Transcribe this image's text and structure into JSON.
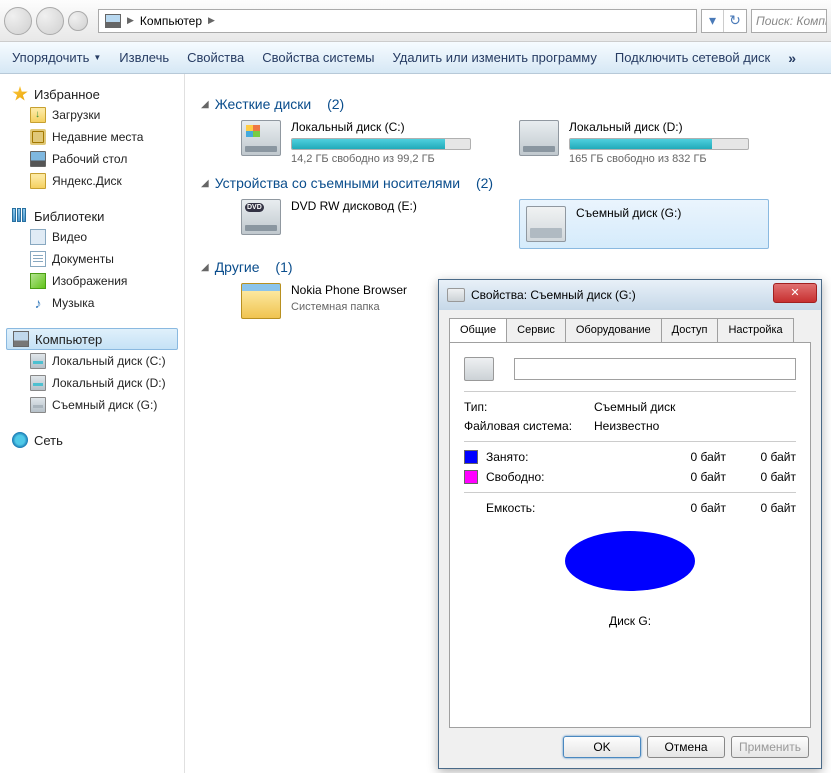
{
  "nav": {
    "breadcrumb_root": "Компьютер",
    "search_placeholder": "Поиск: Компьютер"
  },
  "toolbar": {
    "organize": "Упорядочить",
    "eject": "Извлечь",
    "properties": "Свойства",
    "system_props": "Свойства системы",
    "uninstall": "Удалить или изменить программу",
    "map_drive": "Подключить сетевой диск",
    "overflow": "»"
  },
  "sidebar": {
    "favorites": {
      "title": "Избранное",
      "downloads": "Загрузки",
      "recent": "Недавние места",
      "desktop": "Рабочий стол",
      "yadisk": "Яндекс.Диск"
    },
    "libraries": {
      "title": "Библиотеки",
      "videos": "Видео",
      "documents": "Документы",
      "pictures": "Изображения",
      "music": "Музыка"
    },
    "computer": {
      "title": "Компьютер",
      "disk_c": "Локальный диск (C:)",
      "disk_d": "Локальный диск (D:)",
      "disk_g": "Съемный диск (G:)"
    },
    "network": {
      "title": "Сеть"
    }
  },
  "sections": {
    "hard": {
      "title": "Жесткие диски",
      "count": "(2)"
    },
    "removable": {
      "title": "Устройства со съемными носителями",
      "count": "(2)"
    },
    "other": {
      "title": "Другие",
      "count": "(1)"
    }
  },
  "drives": {
    "c": {
      "title": "Локальный диск (C:)",
      "stats": "14,2 ГБ свободно из 99,2 ГБ",
      "fill_pct": 86
    },
    "d": {
      "title": "Локальный диск (D:)",
      "stats": "165 ГБ свободно из 832 ГБ",
      "fill_pct": 80
    },
    "dvd": {
      "title": "DVD RW дисковод (E:)"
    },
    "g": {
      "title": "Съемный диск (G:)"
    },
    "nokia": {
      "title": "Nokia Phone Browser",
      "subtitle": "Системная папка"
    }
  },
  "dialog": {
    "title": "Свойства: Съемный диск (G:)",
    "tabs": {
      "general": "Общие",
      "tools": "Сервис",
      "hardware": "Оборудование",
      "sharing": "Доступ",
      "customize": "Настройка"
    },
    "type_label": "Тип:",
    "type_value": "Съемный диск",
    "fs_label": "Файловая система:",
    "fs_value": "Неизвестно",
    "used_label": "Занято:",
    "used_v1": "0 байт",
    "used_v2": "0 байт",
    "free_label": "Свободно:",
    "free_v1": "0 байт",
    "free_v2": "0 байт",
    "cap_label": "Емкость:",
    "cap_v1": "0 байт",
    "cap_v2": "0 байт",
    "disk_label": "Диск G:",
    "ok": "OK",
    "cancel": "Отмена",
    "apply": "Применить"
  }
}
